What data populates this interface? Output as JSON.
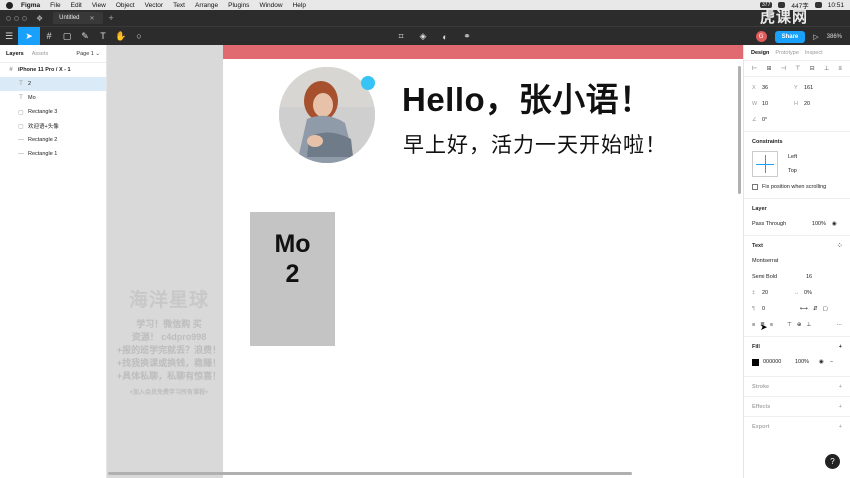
{
  "menubar": {
    "app": "Figma",
    "items": [
      "File",
      "Edit",
      "View",
      "Object",
      "Vector",
      "Text",
      "Arrange",
      "Plugins",
      "Window",
      "Help"
    ],
    "battery": "447字",
    "time": "10:51",
    "badge": "377"
  },
  "tabbar": {
    "tab_title": "Untitled"
  },
  "toolbar": {
    "share_label": "Share",
    "zoom": "386%",
    "avatar_letter": "G"
  },
  "layers_panel": {
    "tab_layers": "Layers",
    "tab_assets": "Assets",
    "page": "Page 1 ⌄",
    "frame": "iPhone 11 Pro / X - 1",
    "items": [
      {
        "icon": "T",
        "label": "2",
        "selected": true
      },
      {
        "icon": "T",
        "label": "Mo",
        "selected": false
      },
      {
        "icon": "▢",
        "label": "Rectangle 3",
        "selected": false
      },
      {
        "icon": "▢",
        "label": "欢迎语+头像",
        "selected": false
      },
      {
        "icon": "—",
        "label": "Rectangle 2",
        "selected": false
      },
      {
        "icon": "—",
        "label": "Rectangle 1",
        "selected": false
      }
    ]
  },
  "canvas": {
    "hello_text": "Hello，张小语！",
    "greeting_text": "早上好，活力一天开始啦！",
    "mo_line1": "Mo",
    "mo_line2": "2",
    "watermark": {
      "title": "海洋星球",
      "line1": "学习！微信购 买",
      "line2": "资源！ c4dpro998",
      "line3": "+报的班学完就丢？浪费！",
      "line4": "+找我换课或换钱，稳赚！",
      "line5": "+具体私聊，私聊有惊喜！",
      "small": "+加入会员免费学习所有课程+"
    },
    "colors": {
      "red_bar": "#e06a70",
      "blue_dot": "#35c4f5",
      "mo_rect": "#c4c4c4"
    }
  },
  "design_panel": {
    "tab_design": "Design",
    "tab_prototype": "Prototype",
    "tab_inspect": "Inspect",
    "x": "36",
    "y": "161",
    "w": "10",
    "h": "20",
    "rotation": "0°",
    "constraints_title": "Constraints",
    "constraint_h": "Left",
    "constraint_v": "Top",
    "fix_position": "Fix position when scrolling",
    "layer_title": "Layer",
    "blend": "Pass Through",
    "opacity": "100%",
    "text_title": "Text",
    "font_family": "Montserrat",
    "font_weight": "Semi Bold",
    "font_size": "16",
    "line_height": "20",
    "letter_spacing": "0%",
    "paragraph_spacing": "0",
    "fill_title": "Fill",
    "fill_hex": "000000",
    "fill_opacity": "100%",
    "stroke_title": "Stroke",
    "effects_title": "Effects",
    "export_title": "Export",
    "help": "?"
  },
  "brand_watermark": "虎课网"
}
